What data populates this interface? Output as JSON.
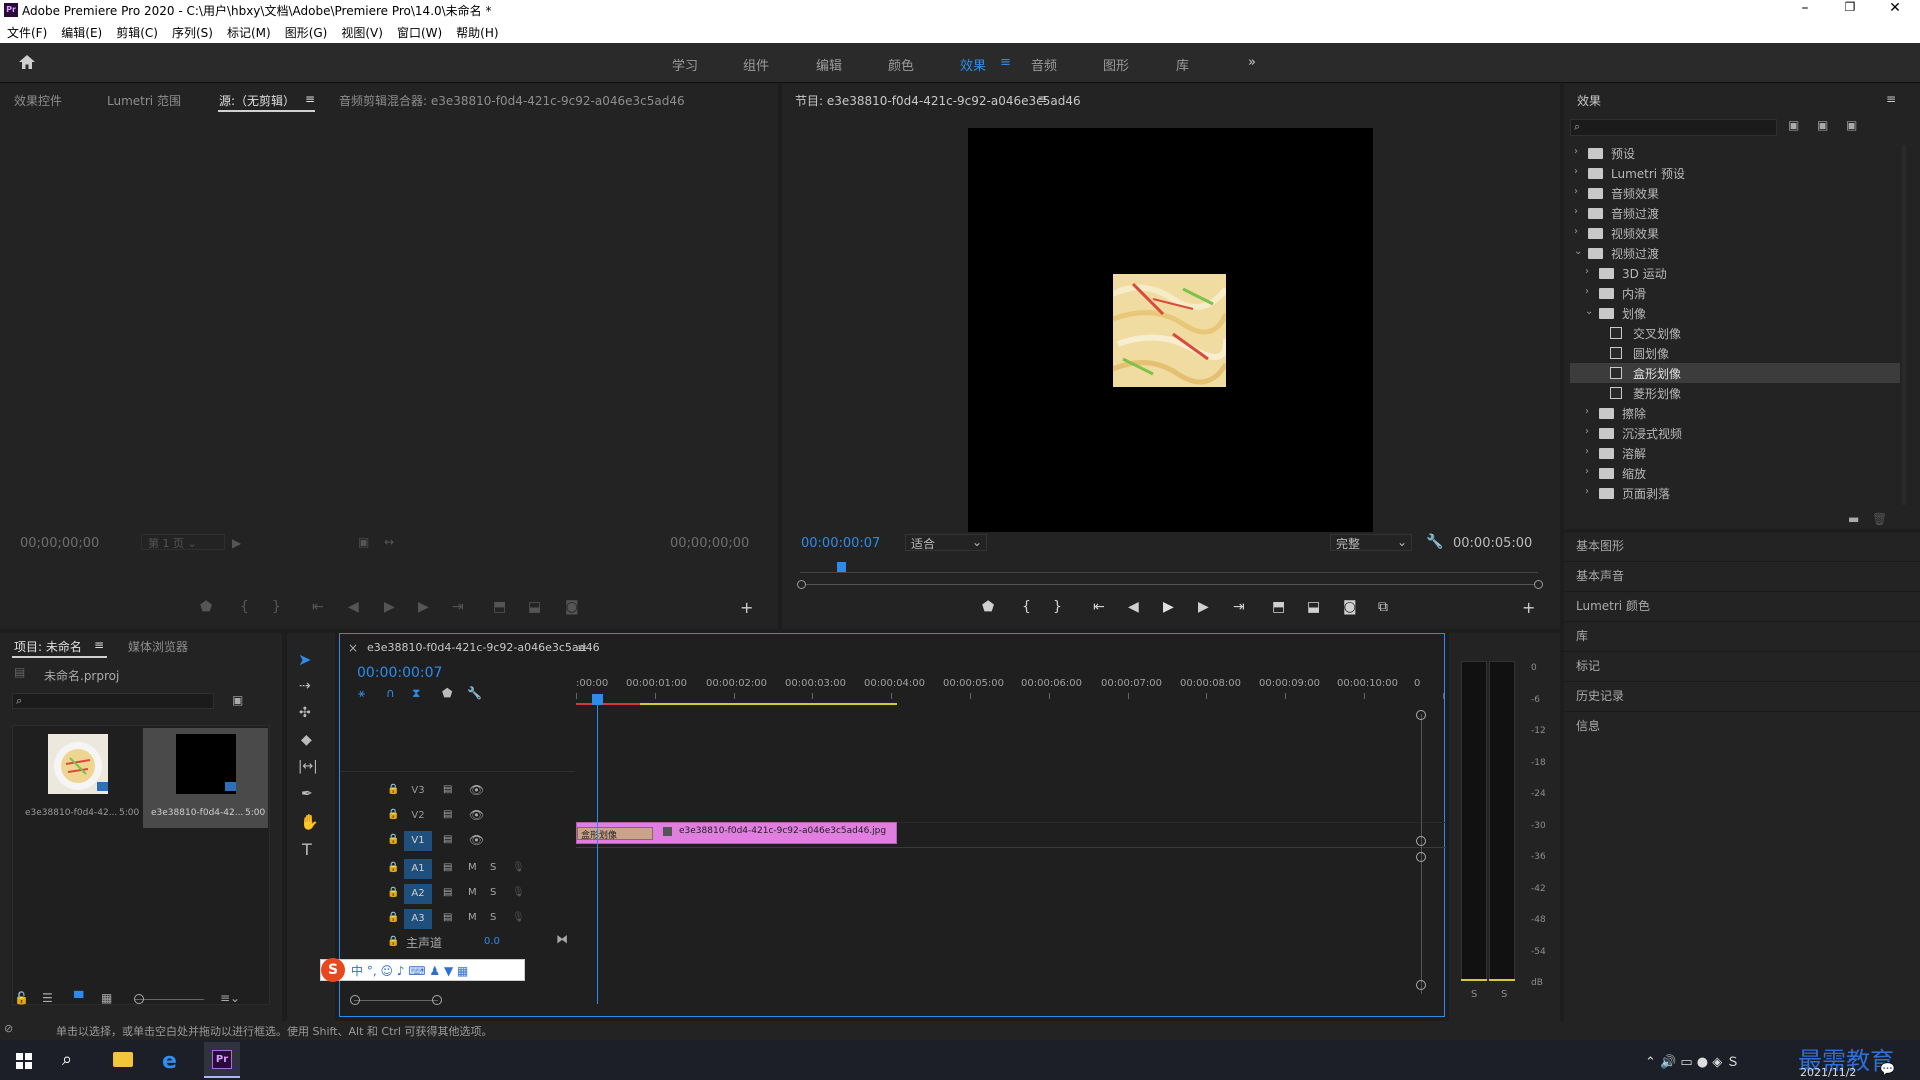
{
  "window": {
    "title": "Adobe Premiere Pro 2020 - C:\\用户\\hbxy\\文档\\Adobe\\Premiere Pro\\14.0\\未命名 *"
  },
  "menu": [
    "文件(F)",
    "编辑(E)",
    "剪辑(C)",
    "序列(S)",
    "标记(M)",
    "图形(G)",
    "视图(V)",
    "窗口(W)",
    "帮助(H)"
  ],
  "workspaces": [
    "学习",
    "组件",
    "编辑",
    "颜色",
    "效果",
    "音频",
    "图形",
    "库"
  ],
  "workspace_active": "效果",
  "source_panel": {
    "tabs": [
      "效果控件",
      "Lumetri 范围",
      "源:（无剪辑）",
      "音频剪辑混合器: e3e38810-f0d4-421c-9c92-a046e3c5ad46"
    ],
    "timecode_in": "00;00;00;00",
    "timecode_out": "00;00;00;00",
    "page_select": "第 1 页"
  },
  "program_panel": {
    "title": "节目: e3e38810-f0d4-421c-9c92-a046e3c5ad46",
    "timecode": "00:00:00:07",
    "fit": "适合",
    "quality": "完整",
    "duration": "00:00:05:00",
    "playhead_fraction": 0.05
  },
  "effects_panel": {
    "title": "效果",
    "tree": [
      {
        "label": "预设",
        "level": 0,
        "kind": "preset",
        "open": false
      },
      {
        "label": "Lumetri 预设",
        "level": 0,
        "kind": "preset",
        "open": false
      },
      {
        "label": "音频效果",
        "level": 0,
        "kind": "folder",
        "open": false
      },
      {
        "label": "音频过渡",
        "level": 0,
        "kind": "folder",
        "open": false
      },
      {
        "label": "视频效果",
        "level": 0,
        "kind": "folder",
        "open": false
      },
      {
        "label": "视频过渡",
        "level": 0,
        "kind": "folder",
        "open": true
      },
      {
        "label": "3D 运动",
        "level": 1,
        "kind": "folder",
        "open": false
      },
      {
        "label": "内滑",
        "level": 1,
        "kind": "folder",
        "open": false
      },
      {
        "label": "划像",
        "level": 1,
        "kind": "folder",
        "open": true
      },
      {
        "label": "交叉划像",
        "level": 2,
        "kind": "item"
      },
      {
        "label": "圆划像",
        "level": 2,
        "kind": "item"
      },
      {
        "label": "盒形划像",
        "level": 2,
        "kind": "item",
        "selected": true
      },
      {
        "label": "菱形划像",
        "level": 2,
        "kind": "item"
      },
      {
        "label": "擦除",
        "level": 1,
        "kind": "folder",
        "open": false
      },
      {
        "label": "沉浸式视频",
        "level": 1,
        "kind": "folder",
        "open": false
      },
      {
        "label": "溶解",
        "level": 1,
        "kind": "folder",
        "open": false
      },
      {
        "label": "缩放",
        "level": 1,
        "kind": "folder",
        "open": false
      },
      {
        "label": "页面剥落",
        "level": 1,
        "kind": "folder",
        "open": false
      }
    ],
    "side_panels": [
      "基本图形",
      "基本声音",
      "Lumetri 颜色",
      "库",
      "标记",
      "历史记录",
      "信息"
    ]
  },
  "project_panel": {
    "tabs": [
      "项目: 未命名",
      "媒体浏览器"
    ],
    "file": "未命名.prproj",
    "items": [
      {
        "name": "e3e38810-f0d4-42...",
        "duration": "5:00"
      },
      {
        "name": "e3e38810-f0d4-42...",
        "duration": "5:00"
      }
    ]
  },
  "timeline": {
    "sequence": "e3e38810-f0d4-421c-9c92-a046e3c5ad46",
    "timecode": "00:00:00:07",
    "ruler": [
      ":00:00",
      "00:00:01:00",
      "00:00:02:00",
      "00:00:03:00",
      "00:00:04:00",
      "00:00:05:00",
      "00:00:06:00",
      "00:00:07:00",
      "00:00:08:00",
      "00:00:09:00",
      "00:00:10:00",
      "0"
    ],
    "video_tracks": [
      "V3",
      "V2",
      "V1"
    ],
    "audio_tracks": [
      "A1",
      "A2",
      "A3"
    ],
    "master": "主声道",
    "master_value": "0.0",
    "transition_label": "盒形划像",
    "clip_name": "e3e38810-f0d4-421c-9c92-a046e3c5ad46.jpg"
  },
  "meter": {
    "labels": [
      "0",
      "-6",
      "-12",
      "-18",
      "-24",
      "-30",
      "-36",
      "-42",
      "-48",
      "-54",
      "dB"
    ],
    "solo": [
      "S",
      "S"
    ]
  },
  "status": "单击以选择，或单击空白处并拖动以进行框选。使用 Shift、Alt 和 Ctrl 可获得其他选项。",
  "taskbar": {
    "watermark": "最需教育",
    "date": "2021/11/2"
  },
  "colors": {
    "accent": "#2d8ceb",
    "clip": "#e07fe0",
    "transition": "#c9a48a",
    "workarea": "#d4c93a",
    "render_red": "#d03b3b"
  }
}
